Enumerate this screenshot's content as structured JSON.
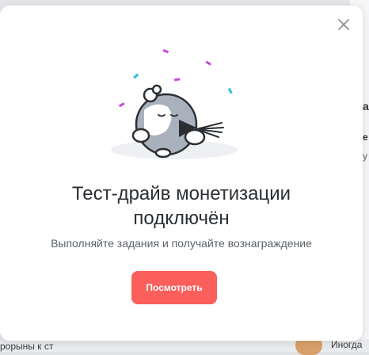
{
  "modal": {
    "title_line1": "Тест-драйв монетизации",
    "title_line2": "подключён",
    "subtitle": "Выполняйте задания и получайте вознаграждение",
    "action_label": "Посмотреть",
    "close_icon": "close-icon",
    "illustration_icon": "party-blower-character-icon"
  },
  "background": {
    "bottom_left_text": "рорыны к ст",
    "bottom_right_text": "Иногда",
    "side_text_1": "а",
    "side_text_2": "e",
    "side_text_3": "y"
  },
  "colors": {
    "accent_button": "#fb5f5b",
    "title_text": "#2b2f33",
    "subtitle_text": "#5c626a",
    "confetti_pink": "#c54ad8",
    "confetti_teal": "#2fc0d6"
  }
}
